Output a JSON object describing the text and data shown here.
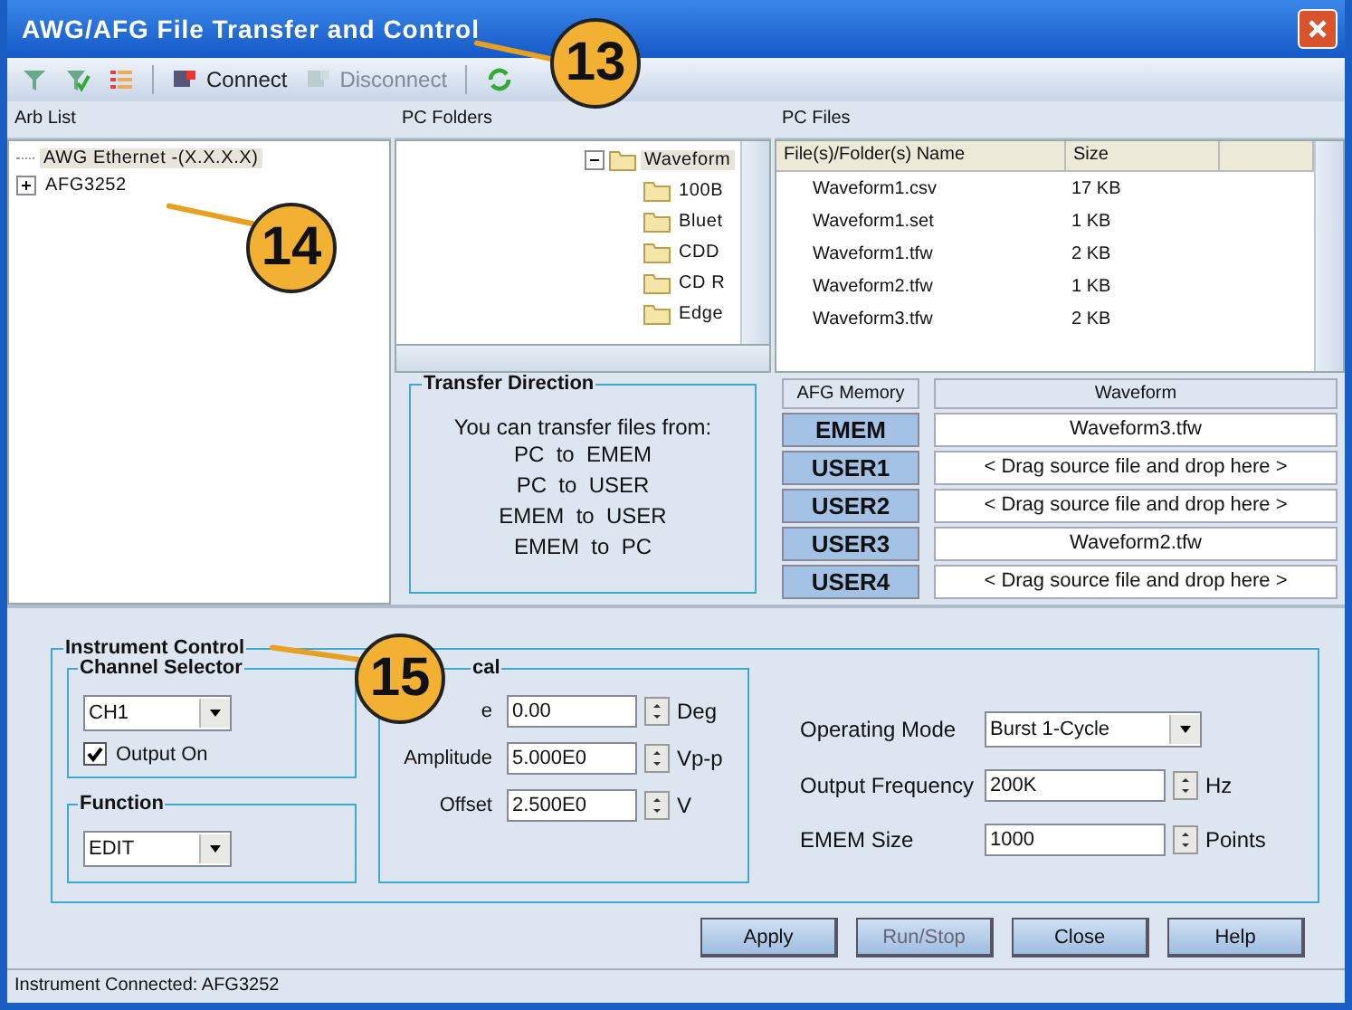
{
  "window": {
    "title": "AWG/AFG File Transfer and Control"
  },
  "toolbar": [
    {
      "label": "Connect",
      "disabled": false
    },
    {
      "label": "Disconnect",
      "disabled": true
    }
  ],
  "arb_list": {
    "title": "Arb List",
    "items": [
      {
        "label": "AWG Ethernet -(X.X.X.X)",
        "kind": "leaf",
        "selected": true
      },
      {
        "label": "AFG3252",
        "kind": "node",
        "expanded": false,
        "selected": false
      }
    ]
  },
  "pc_folders": {
    "title": "PC Folders",
    "items": [
      {
        "label": "Waveform",
        "expanded": true,
        "selected": true,
        "children": [
          {
            "label": "100B"
          },
          {
            "label": "Bluet"
          },
          {
            "label": "CDD"
          },
          {
            "label": "CD R"
          },
          {
            "label": "Edge"
          }
        ]
      }
    ]
  },
  "pc_files": {
    "title": "PC Files",
    "columns": [
      "File(s)/Folder(s) Name",
      "Size"
    ],
    "rows": [
      [
        "Waveform1.csv",
        "17 KB"
      ],
      [
        "Waveform1.set",
        "1 KB"
      ],
      [
        "Waveform1.tfw",
        "2 KB"
      ],
      [
        "Waveform2.tfw",
        "1 KB"
      ],
      [
        "Waveform3.tfw",
        "2 KB"
      ]
    ]
  },
  "transfer_direction": {
    "title": "Transfer Direction",
    "intro": "You can transfer files from:",
    "lines": [
      "PC  to  EMEM",
      "PC  to  USER",
      "EMEM  to  USER",
      "EMEM  to  PC"
    ]
  },
  "afg_memory": {
    "columns": [
      "AFG Memory",
      "Waveform"
    ],
    "rows": [
      {
        "memory": "EMEM",
        "waveform": "Waveform3.tfw"
      },
      {
        "memory": "USER1",
        "waveform": "< Drag source file and drop here >"
      },
      {
        "memory": "USER2",
        "waveform": "< Drag source file and drop here >"
      },
      {
        "memory": "USER3",
        "waveform": "Waveform2.tfw"
      },
      {
        "memory": "USER4",
        "waveform": "< Drag source file and drop here >"
      }
    ]
  },
  "instrument_control": {
    "title": "Instrument Control",
    "channel_selector": {
      "title": "Channel Selector",
      "channel": "CH1",
      "output_on": {
        "label": "Output On",
        "checked": true
      }
    },
    "function": {
      "title": "Function",
      "value": "EDIT"
    },
    "vertical": {
      "title": "cal",
      "rows": [
        {
          "label": "e",
          "value": "0.00",
          "unit": "Deg"
        },
        {
          "label": "Amplitude",
          "value": "5.000E0",
          "unit": "Vp-p"
        },
        {
          "label": "Offset",
          "value": "2.500E0",
          "unit": "V"
        }
      ]
    },
    "settings": [
      {
        "label": "Operating Mode",
        "kind": "dropdown",
        "value": "Burst 1-Cycle"
      },
      {
        "label": "Output Frequency",
        "kind": "spin",
        "value": "200K",
        "unit": "Hz"
      },
      {
        "label": "EMEM Size",
        "kind": "spin",
        "value": "1000",
        "unit": "Points"
      }
    ]
  },
  "buttons": [
    {
      "label": "Apply",
      "disabled": false
    },
    {
      "label": "Run/Stop",
      "disabled": true
    },
    {
      "label": "Close",
      "disabled": false
    },
    {
      "label": "Help",
      "disabled": false
    }
  ],
  "status_bar": "Instrument Connected: AFG3252",
  "callouts": [
    "13",
    "14",
    "15"
  ]
}
